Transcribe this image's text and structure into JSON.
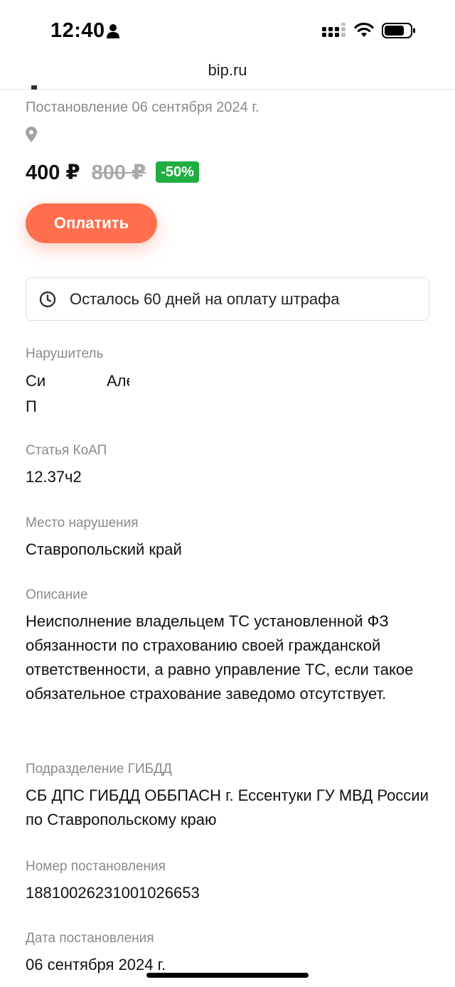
{
  "status_bar": {
    "time": "12:40"
  },
  "browser": {
    "url": "bip.ru"
  },
  "fine": {
    "resolution_line": "Постановление 06 сентября 2024 г.",
    "price_now": "400 ₽",
    "price_old": "800 ₽",
    "discount": "-50%",
    "pay_label": "Оплатить",
    "notice": "Осталось 60 дней на оплату штрафа"
  },
  "details": {
    "violator": {
      "label": "Нарушитель",
      "visible_fragments": [
        "Си",
        "Але",
        "П"
      ]
    },
    "article": {
      "label": "Статья КоАП",
      "value": "12.37ч2"
    },
    "place": {
      "label": "Место нарушения",
      "value": "Ставропольский край"
    },
    "description": {
      "label": "Описание",
      "value": "Неисполнение владельцем ТС установленной ФЗ обязанности по страхованию своей гражданской ответственности, а равно управление ТС, если такое обязательное страхование заведомо отсутствует."
    },
    "department": {
      "label": "Подразделение ГИБДД",
      "value": "СБ ДПС ГИБДД ОББПАСН г. Ессентуки ГУ МВД России по Ставропольскому краю"
    },
    "resolution_number": {
      "label": "Номер постановления",
      "value": "18810026231001026653"
    },
    "resolution_date": {
      "label": "Дата постановления",
      "value": "06 сентября 2024 г."
    }
  },
  "colors": {
    "accent": "#ff6f4e",
    "discount_green": "#1fae3f",
    "label_gray": "#8a8a8a"
  },
  "icons": [
    "person-icon",
    "signal-icon",
    "wifi-icon",
    "battery-icon",
    "location-pin-icon",
    "clock-icon"
  ]
}
